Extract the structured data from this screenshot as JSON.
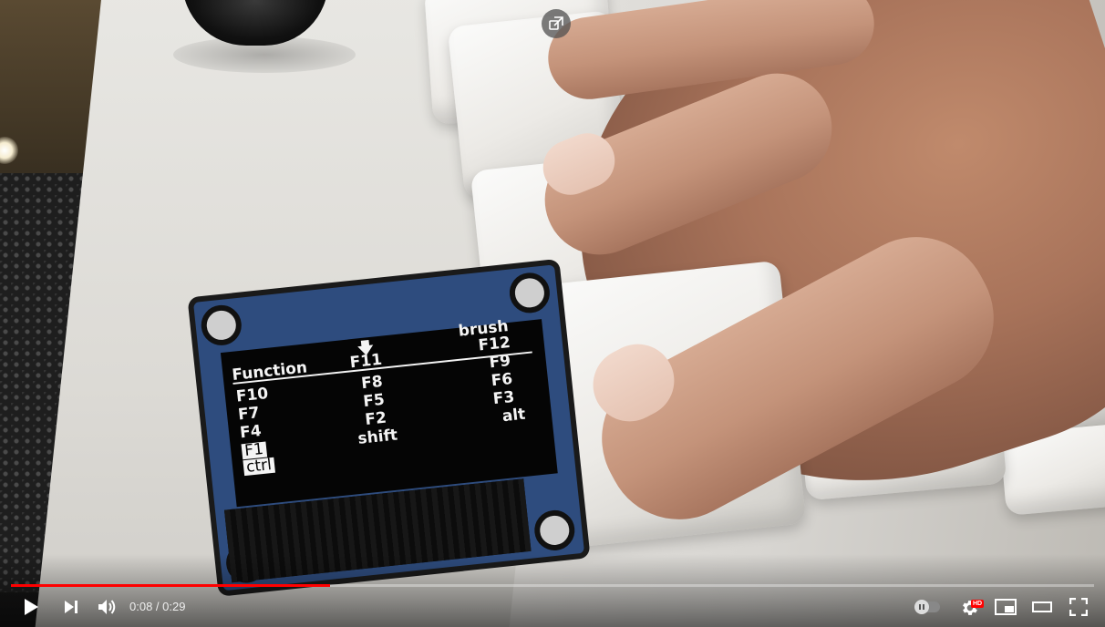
{
  "video": {
    "oled": {
      "col1": [
        "Function",
        "F10",
        "F7",
        "F4",
        "F1",
        "ctrl"
      ],
      "col2": [
        "F11",
        "F8",
        "F5",
        "F2",
        "shift"
      ],
      "col3": [
        "brush",
        "F12",
        "F9",
        "F6",
        "F3",
        "alt"
      ]
    }
  },
  "player": {
    "time_current": "0:08",
    "time_separator": " / ",
    "time_total": "0:29",
    "progress_played": 0.295,
    "progress_loaded": 0.295,
    "accent_color": "#ff0000",
    "hd_label": "HD",
    "icons": {
      "share": "share-icon",
      "play": "play-icon",
      "next": "next-icon",
      "volume": "volume-icon",
      "autoplay": "autoplay-toggle",
      "settings": "gear-icon",
      "miniplayer": "miniplayer-icon",
      "theater": "theater-icon",
      "fullscreen": "fullscreen-icon"
    }
  }
}
